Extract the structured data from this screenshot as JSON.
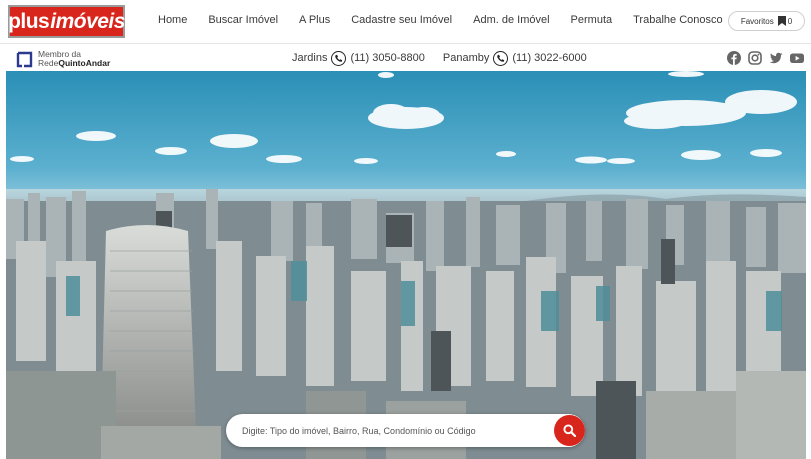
{
  "brand": {
    "logo_part1": "plus",
    "logo_part2": "imóveis",
    "accent_color": "#d9261c"
  },
  "nav": {
    "items": [
      {
        "label": "Home"
      },
      {
        "label": "Buscar Imóvel"
      },
      {
        "label": "A Plus"
      },
      {
        "label": "Cadastre seu Imóvel"
      },
      {
        "label": "Adm. de Imóvel"
      },
      {
        "label": "Permuta"
      },
      {
        "label": "Trabalhe Conosco"
      }
    ],
    "favorites": {
      "label": "Favoritos",
      "count": "0",
      "icon": "bookmark-icon"
    }
  },
  "infobar": {
    "quintoandar": {
      "line1": "Membro da",
      "line2_prefix": "Rede",
      "line2_brand": "QuintoAndar",
      "icon": "quintoandar-logo-icon"
    },
    "phones": [
      {
        "unit": "Jardins",
        "number": "(11) 3050-8800",
        "icon": "whatsapp-icon"
      },
      {
        "unit": "Panamby",
        "number": "(11) 3022-6000",
        "icon": "whatsapp-icon"
      }
    ],
    "socials": [
      {
        "name": "facebook-icon"
      },
      {
        "name": "instagram-icon"
      },
      {
        "name": "twitter-icon"
      },
      {
        "name": "youtube-icon"
      }
    ]
  },
  "hero": {
    "search": {
      "placeholder": "Digite: Tipo do imóvel, Bairro, Rua, Condomínio ou Código",
      "value": "",
      "button_icon": "search-icon"
    }
  }
}
